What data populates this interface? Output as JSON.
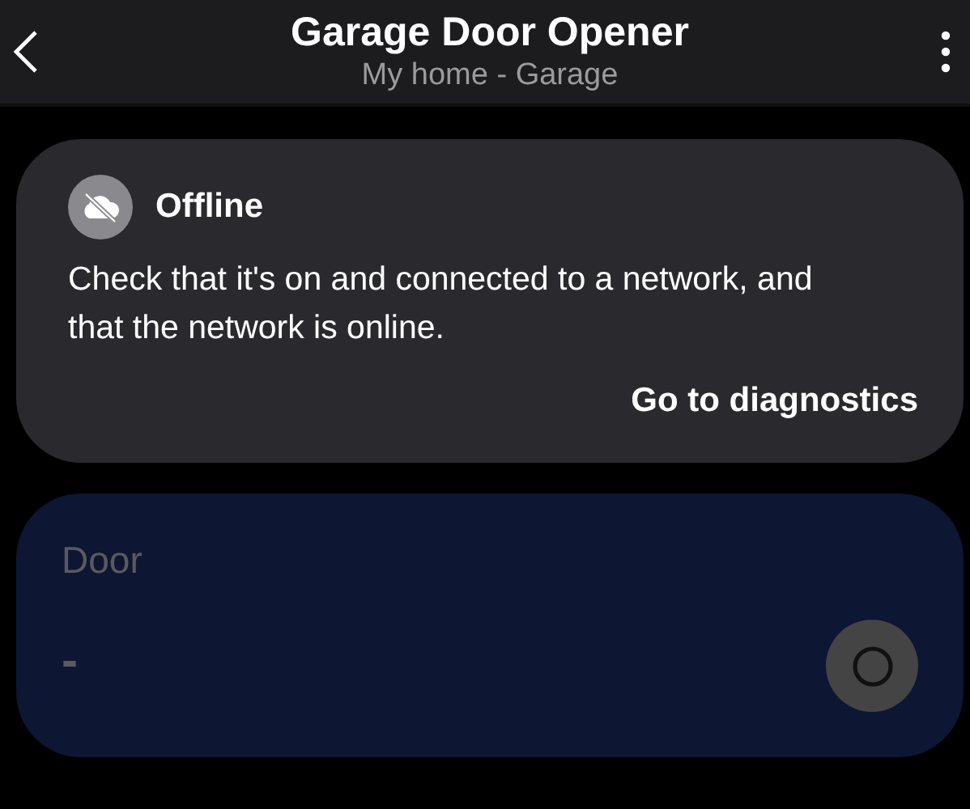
{
  "header": {
    "title": "Garage Door Opener",
    "subtitle": "My home - Garage"
  },
  "alert": {
    "title": "Offline",
    "message": "Check that it's on and connected to a network, and that the network is online.",
    "action": "Go to diagnostics"
  },
  "device": {
    "label": "Door",
    "value": "-",
    "disabled": true
  }
}
